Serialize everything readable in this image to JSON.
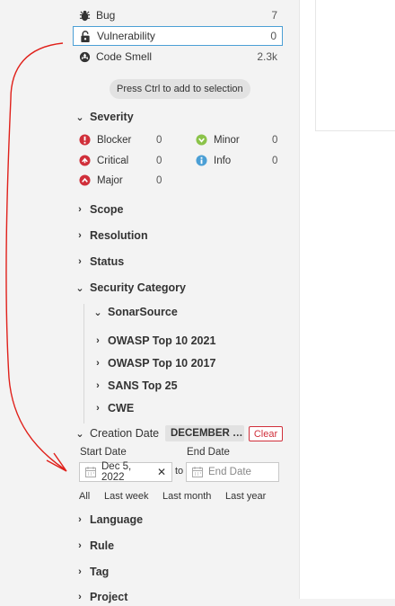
{
  "issue_types": [
    {
      "label": "Bug",
      "count": "7",
      "icon": "bug-icon"
    },
    {
      "label": "Vulnerability",
      "count": "0",
      "icon": "lock-icon"
    },
    {
      "label": "Code Smell",
      "count": "2.3k",
      "icon": "code-smell-icon"
    }
  ],
  "hint": "Press Ctrl to add to selection",
  "severity": {
    "title": "Severity",
    "items": [
      {
        "label": "Blocker",
        "count": "0",
        "icon": "blocker-icon",
        "color": "#d02f3a"
      },
      {
        "label": "Critical",
        "count": "0",
        "icon": "critical-icon",
        "color": "#d02f3a"
      },
      {
        "label": "Major",
        "count": "0",
        "icon": "major-icon",
        "color": "#d02f3a"
      },
      {
        "label": "Minor",
        "count": "0",
        "icon": "minor-icon",
        "color": "#8bc34a"
      },
      {
        "label": "Info",
        "count": "0",
        "icon": "info-icon",
        "color": "#4b9fd5"
      }
    ]
  },
  "facets": {
    "scope": "Scope",
    "resolution": "Resolution",
    "status": "Status",
    "security_category": "Security Category",
    "creation_date": "Creation Date",
    "language": "Language",
    "rule": "Rule",
    "tag": "Tag",
    "project": "Project"
  },
  "security_category": {
    "sonarsource": "SonarSource",
    "items": [
      "OWASP Top 10 2021",
      "OWASP Top 10 2017",
      "SANS Top 25",
      "CWE"
    ]
  },
  "creation_date": {
    "value": "DECEMBER …",
    "clear": "Clear",
    "start_label": "Start Date",
    "end_label": "End Date",
    "start_value": "Dec 5, 2022",
    "end_placeholder": "End Date",
    "to": "to",
    "quick": [
      "All",
      "Last week",
      "Last month",
      "Last year"
    ]
  },
  "colors": {
    "selected_border": "#4b9fd5",
    "danger": "#d02f3a",
    "annotation": "#e0201a"
  }
}
